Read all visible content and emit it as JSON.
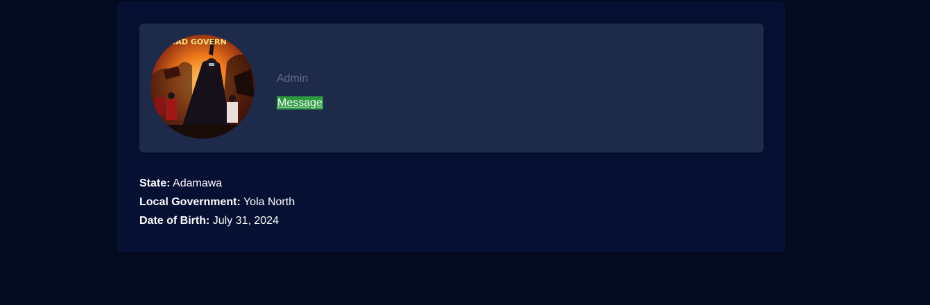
{
  "profile": {
    "avatar_icon": "protest-poster-avatar-image",
    "avatar_text": "BAD GOVERN",
    "role": "Admin",
    "message_label": "Message"
  },
  "details": [
    {
      "label": "State:",
      "value": "Adamawa"
    },
    {
      "label": "Local Government:",
      "value": "Yola North"
    },
    {
      "label": "Date of Birth:",
      "value": "July 31, 2024"
    }
  ],
  "colors": {
    "page_background": "#040c22",
    "card_background": "#061033",
    "header_panel": "#1e2a4a",
    "role_text": "#5d6883",
    "message_highlight": "#2b9a3e"
  }
}
